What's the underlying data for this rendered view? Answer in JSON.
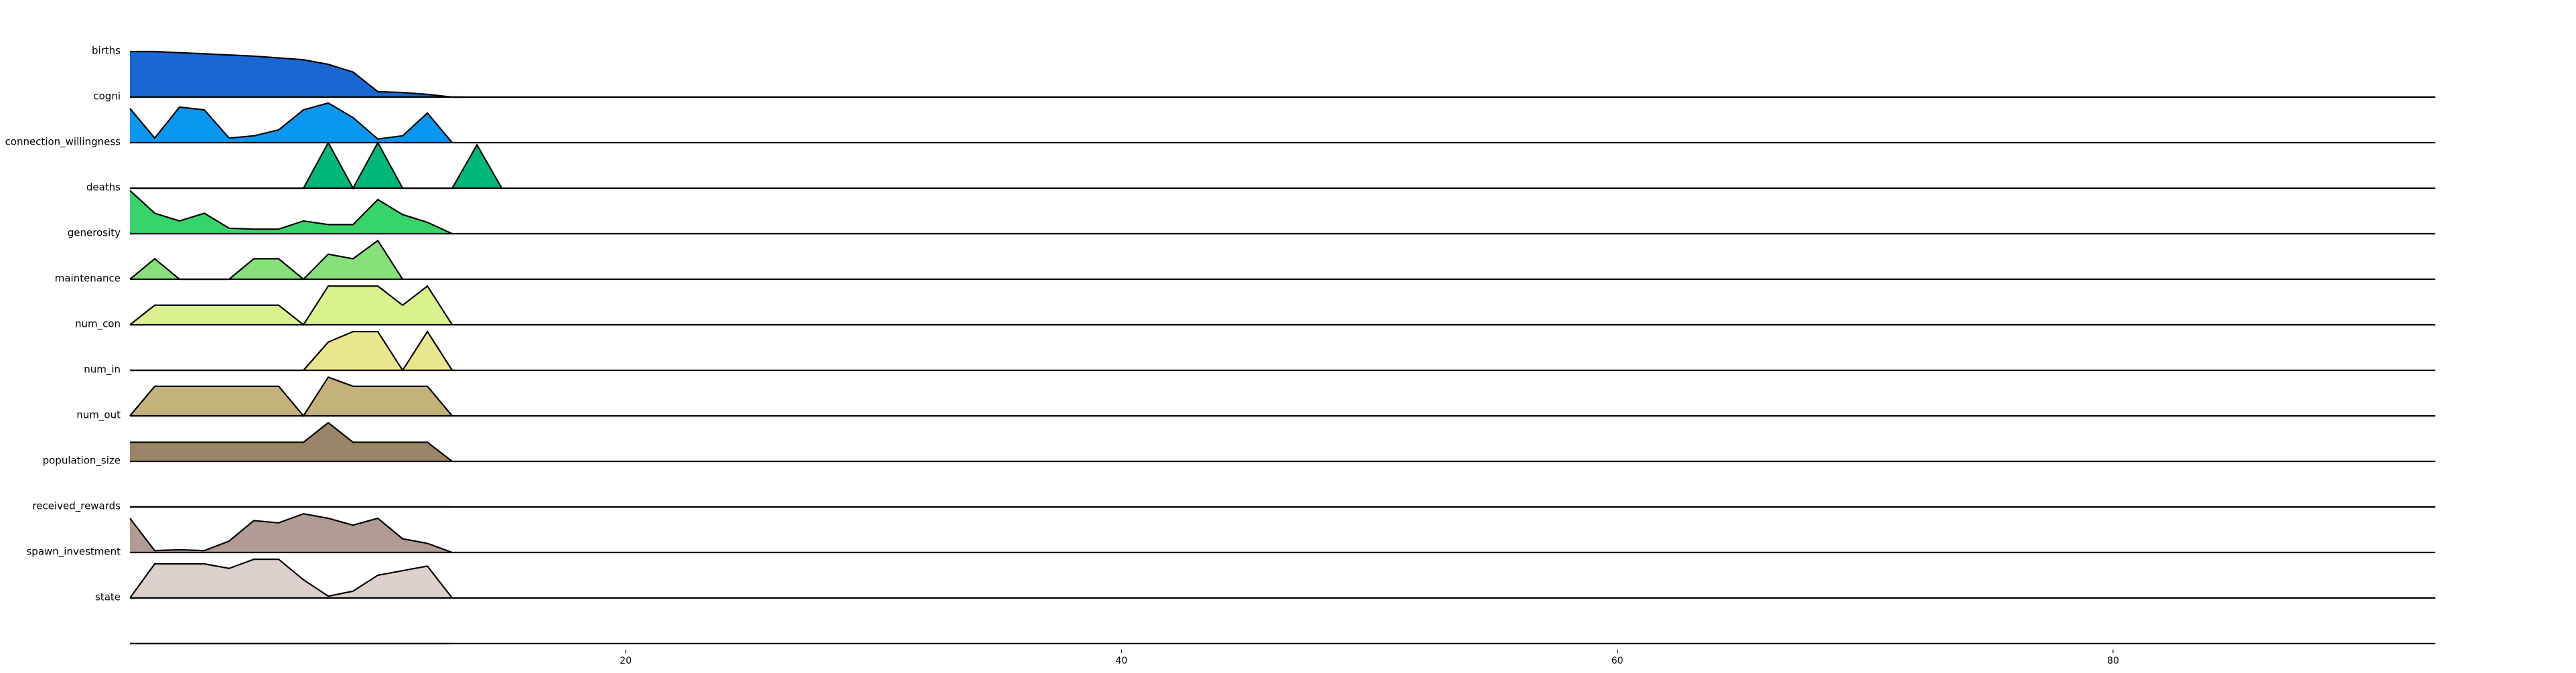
{
  "chart_data": {
    "type": "area",
    "title": "",
    "xlabel": "",
    "ylabel": "",
    "xlim": [
      0,
      93
    ],
    "x_ticks": [
      20,
      40,
      60,
      80
    ],
    "x_tick_labels": [
      "20",
      "40",
      "60",
      "80"
    ],
    "grid": false,
    "legend": "none",
    "series": [
      {
        "name": "births",
        "color": "#1967d2",
        "points": [
          [
            0,
            1.0
          ],
          [
            1,
            1.0
          ],
          [
            3,
            0.95
          ],
          [
            5,
            0.9
          ],
          [
            7,
            0.82
          ],
          [
            8,
            0.72
          ],
          [
            9,
            0.55
          ],
          [
            10,
            0.12
          ],
          [
            11,
            0.1
          ],
          [
            12,
            0.06
          ],
          [
            13,
            0.0
          ],
          [
            13.5,
            0.0
          ]
        ]
      },
      {
        "name": "cogni",
        "color": "#0a97f0",
        "points": [
          [
            0,
            0.75
          ],
          [
            1,
            0.1
          ],
          [
            2,
            0.78
          ],
          [
            3,
            0.72
          ],
          [
            4,
            0.1
          ],
          [
            5,
            0.15
          ],
          [
            6,
            0.28
          ],
          [
            7,
            0.72
          ],
          [
            8,
            0.87
          ],
          [
            9,
            0.55
          ],
          [
            10,
            0.08
          ],
          [
            11,
            0.15
          ],
          [
            12,
            0.65
          ],
          [
            13,
            0.0
          ]
        ]
      },
      {
        "name": "connection_willingness",
        "color": "#00b87a",
        "points": [
          [
            0,
            0.0
          ],
          [
            1,
            0.0
          ],
          [
            7,
            0.0
          ],
          [
            8,
            1.0
          ],
          [
            9,
            0.0
          ],
          [
            10,
            1.0
          ],
          [
            11,
            0.0
          ],
          [
            12,
            0.0
          ],
          [
            13,
            0.0
          ],
          [
            14,
            0.95
          ],
          [
            15,
            0.0
          ]
        ]
      },
      {
        "name": "deaths",
        "color": "#37d46b",
        "points": [
          [
            0,
            0.95
          ],
          [
            1,
            0.45
          ],
          [
            2,
            0.28
          ],
          [
            3,
            0.45
          ],
          [
            4,
            0.12
          ],
          [
            5,
            0.1
          ],
          [
            6,
            0.1
          ],
          [
            7,
            0.28
          ],
          [
            8,
            0.2
          ],
          [
            9,
            0.2
          ],
          [
            10,
            0.75
          ],
          [
            11,
            0.42
          ],
          [
            12,
            0.25
          ],
          [
            13,
            0.0
          ]
        ]
      },
      {
        "name": "generosity",
        "color": "#87e07a",
        "points": [
          [
            0,
            0.0
          ],
          [
            1,
            0.45
          ],
          [
            2,
            0.0
          ],
          [
            3,
            0.0
          ],
          [
            4,
            0.0
          ],
          [
            5,
            0.45
          ],
          [
            6,
            0.45
          ],
          [
            7,
            0.0
          ],
          [
            8,
            0.55
          ],
          [
            9,
            0.45
          ],
          [
            10,
            0.85
          ],
          [
            11,
            0.0
          ]
        ]
      },
      {
        "name": "maintenance",
        "color": "#d9f28e",
        "points": [
          [
            0,
            0.0
          ],
          [
            1,
            0.43
          ],
          [
            2,
            0.43
          ],
          [
            3,
            0.43
          ],
          [
            4,
            0.43
          ],
          [
            5,
            0.43
          ],
          [
            6,
            0.43
          ],
          [
            7,
            0.0
          ],
          [
            8,
            0.85
          ],
          [
            9,
            0.85
          ],
          [
            10,
            0.85
          ],
          [
            11,
            0.43
          ],
          [
            12,
            0.85
          ],
          [
            13,
            0.0
          ]
        ]
      },
      {
        "name": "num_con",
        "color": "#eae68f",
        "points": [
          [
            0,
            0.0
          ],
          [
            7,
            0.0
          ],
          [
            8,
            0.62
          ],
          [
            9,
            0.85
          ],
          [
            10,
            0.85
          ],
          [
            11,
            0.0
          ],
          [
            12,
            0.85
          ],
          [
            13,
            0.0
          ]
        ]
      },
      {
        "name": "num_in",
        "color": "#c4b27a",
        "points": [
          [
            0,
            0.0
          ],
          [
            1,
            0.65
          ],
          [
            2,
            0.65
          ],
          [
            3,
            0.65
          ],
          [
            4,
            0.65
          ],
          [
            5,
            0.65
          ],
          [
            6,
            0.65
          ],
          [
            7,
            0.0
          ],
          [
            8,
            0.85
          ],
          [
            9,
            0.65
          ],
          [
            10,
            0.65
          ],
          [
            11,
            0.65
          ],
          [
            12,
            0.65
          ],
          [
            13,
            0.0
          ]
        ]
      },
      {
        "name": "num_out",
        "color": "#9c8466",
        "points": [
          [
            0,
            0.42
          ],
          [
            1,
            0.42
          ],
          [
            7,
            0.42
          ],
          [
            8,
            0.85
          ],
          [
            9,
            0.42
          ],
          [
            10,
            0.42
          ],
          [
            11,
            0.42
          ],
          [
            12,
            0.42
          ],
          [
            13,
            0.0
          ]
        ]
      },
      {
        "name": "population_size",
        "color": "#ffffff",
        "points": [
          [
            0,
            0.0
          ],
          [
            13,
            0.0
          ]
        ]
      },
      {
        "name": "received_rewards",
        "color": "#b29b95",
        "points": [
          [
            0,
            0.75
          ],
          [
            1,
            0.04
          ],
          [
            2,
            0.06
          ],
          [
            3,
            0.04
          ],
          [
            4,
            0.25
          ],
          [
            5,
            0.7
          ],
          [
            6,
            0.65
          ],
          [
            7,
            0.85
          ],
          [
            8,
            0.75
          ],
          [
            9,
            0.6
          ],
          [
            10,
            0.75
          ],
          [
            11,
            0.3
          ],
          [
            12,
            0.2
          ],
          [
            13,
            0.0
          ]
        ]
      },
      {
        "name": "spawn_investment",
        "color": "#dcd0cc",
        "points": [
          [
            0,
            0.0
          ],
          [
            1,
            0.75
          ],
          [
            2,
            0.75
          ],
          [
            3,
            0.75
          ],
          [
            4,
            0.65
          ],
          [
            5,
            0.85
          ],
          [
            6,
            0.85
          ],
          [
            7,
            0.4
          ],
          [
            8,
            0.04
          ],
          [
            9,
            0.15
          ],
          [
            10,
            0.5
          ],
          [
            11,
            0.6
          ],
          [
            12,
            0.7
          ],
          [
            13,
            0.0
          ]
        ]
      },
      {
        "name": "state",
        "color": "#ffffff",
        "points": [
          [
            0,
            0.0
          ],
          [
            13,
            0.0
          ]
        ]
      }
    ]
  }
}
